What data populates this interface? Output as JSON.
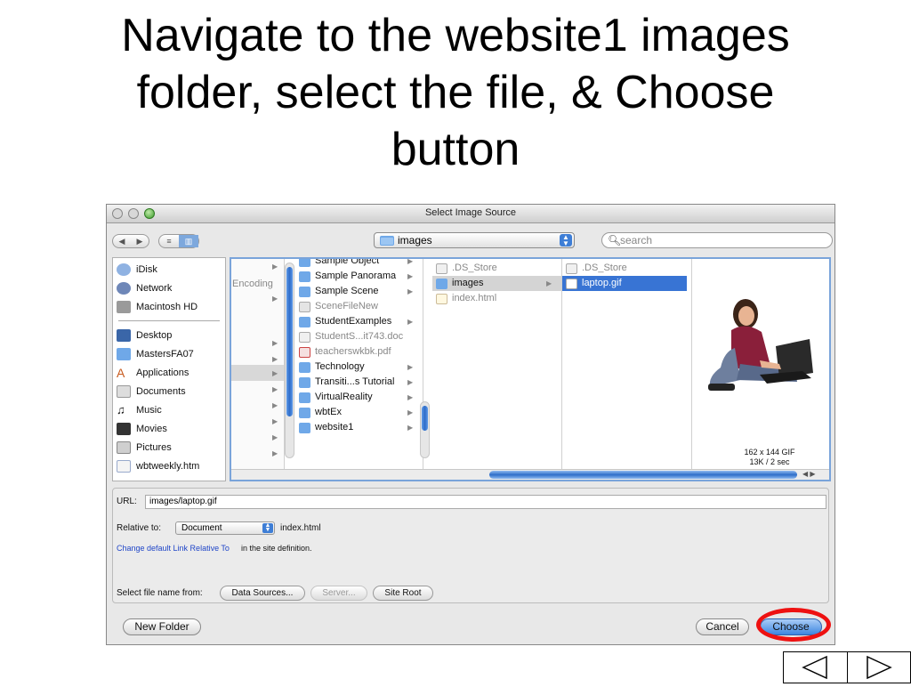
{
  "slide": {
    "title_line1": "Navigate to the website1 images",
    "title_line2": "folder, select the file, & Choose",
    "title_line3": "button"
  },
  "dialog": {
    "title": "Select Image Source",
    "location_popup": "images",
    "search_placeholder": "search",
    "sidebar": [
      {
        "label": "iDisk",
        "icon": "idisk-icon"
      },
      {
        "label": "Network",
        "icon": "network-icon"
      },
      {
        "label": "Macintosh HD",
        "icon": "harddisk-icon"
      },
      {
        "label": "Desktop",
        "icon": "desktop-icon"
      },
      {
        "label": "MastersFA07",
        "icon": "folder-icon"
      },
      {
        "label": "Applications",
        "icon": "applications-icon"
      },
      {
        "label": "Documents",
        "icon": "documents-icon"
      },
      {
        "label": "Music",
        "icon": "music-icon"
      },
      {
        "label": "Movies",
        "icon": "movies-icon"
      },
      {
        "label": "Pictures",
        "icon": "pictures-icon"
      },
      {
        "label": "wbtweekly.htm",
        "icon": "html-file-icon"
      }
    ],
    "column1_label": "Encoding",
    "column2": [
      {
        "label": "Sample Object",
        "kind": "folder",
        "dim": false
      },
      {
        "label": "Sample Panorama",
        "kind": "folder",
        "dim": false
      },
      {
        "label": "Sample Scene",
        "kind": "folder",
        "dim": false
      },
      {
        "label": "SceneFileNew",
        "kind": "file",
        "dim": true
      },
      {
        "label": "StudentExamples",
        "kind": "folder",
        "dim": false
      },
      {
        "label": "StudentS...it743.doc",
        "kind": "file",
        "dim": true
      },
      {
        "label": "teacherswkbk.pdf",
        "kind": "pdf",
        "dim": true
      },
      {
        "label": "Technology",
        "kind": "folder",
        "dim": false
      },
      {
        "label": "Transiti...s Tutorial",
        "kind": "folder",
        "dim": false
      },
      {
        "label": "VirtualReality",
        "kind": "folder",
        "dim": false
      },
      {
        "label": "wbtEx",
        "kind": "folder",
        "dim": false
      },
      {
        "label": "website1",
        "kind": "folder",
        "dim": false
      }
    ],
    "column3": [
      {
        "label": ".DS_Store",
        "kind": "file",
        "selected": false
      },
      {
        "label": "images",
        "kind": "folder",
        "selected": true
      },
      {
        "label": "index.html",
        "kind": "html",
        "selected": false
      }
    ],
    "column4": [
      {
        "label": ".DS_Store",
        "kind": "file",
        "selected": false
      },
      {
        "label": "laptop.gif",
        "kind": "image",
        "selected": true
      }
    ],
    "preview_dimensions": "162 x 144 GIF",
    "preview_size": "13K / 2 sec",
    "url_label": "URL:",
    "url_value": "images/laptop.gif",
    "relative_label": "Relative to:",
    "relative_value": "Document",
    "relative_file": "index.html",
    "change_link": "Change default Link Relative To",
    "change_suffix": "in the site definition.",
    "select_from_label": "Select file name from:",
    "data_sources_button": "Data Sources...",
    "server_button": "Server...",
    "site_root_button": "Site Root",
    "new_folder_button": "New Folder",
    "cancel_button": "Cancel",
    "choose_button": "Choose"
  },
  "colors": {
    "selection": "#3874d4",
    "highlight_ring": "#ee1111",
    "folder": "#6fa8e8"
  }
}
